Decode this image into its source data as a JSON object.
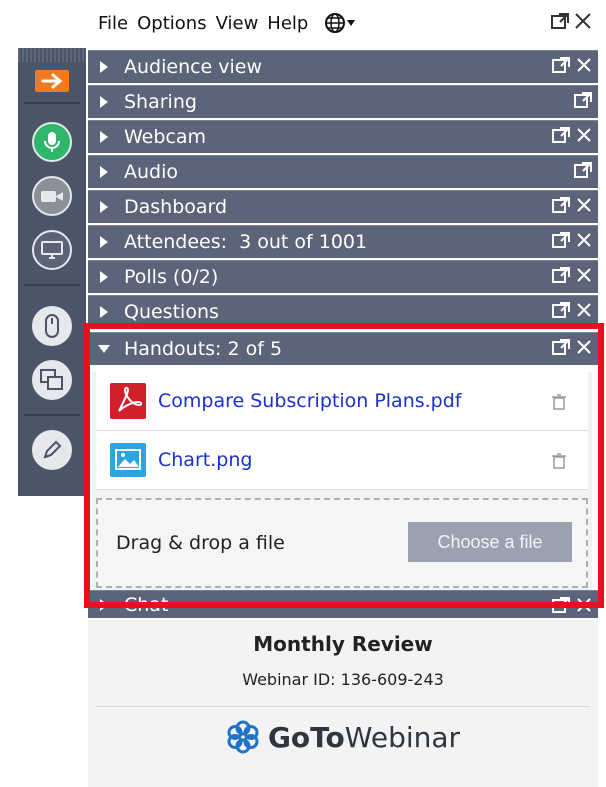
{
  "menu": {
    "items": [
      "File",
      "Options",
      "View",
      "Help"
    ],
    "globe_icon": "globe-icon"
  },
  "sections": [
    {
      "label": "Audience view"
    },
    {
      "label": "Sharing"
    },
    {
      "label": "Webcam"
    },
    {
      "label": "Audio"
    },
    {
      "label": "Dashboard"
    },
    {
      "label": "Attendees:  3 out of 1001"
    },
    {
      "label": "Polls (0/2)"
    },
    {
      "label": "Questions"
    },
    {
      "label": "Handouts: 2 of 5"
    },
    {
      "label": "Chat"
    }
  ],
  "handouts": {
    "files": [
      {
        "name": "Compare Subscription Plans.pdf",
        "icon": "pdf-icon"
      },
      {
        "name": "Chart.png",
        "icon": "image-icon"
      }
    ],
    "drop_text": "Drag & drop a file",
    "choose_label": "Choose a file"
  },
  "footer": {
    "title": "Monthly Review",
    "webinar_id": "Webinar ID: 136-609-243",
    "brand_bold": "GoTo",
    "brand_rest": "Webinar"
  },
  "colors": {
    "section_bg": "#5b6478",
    "toolbar_bg": "#4b5567",
    "highlight": "#e8101f",
    "mic_green": "#2eb66a",
    "arrow_orange": "#f47a20",
    "link_blue": "#1c2fd0"
  }
}
